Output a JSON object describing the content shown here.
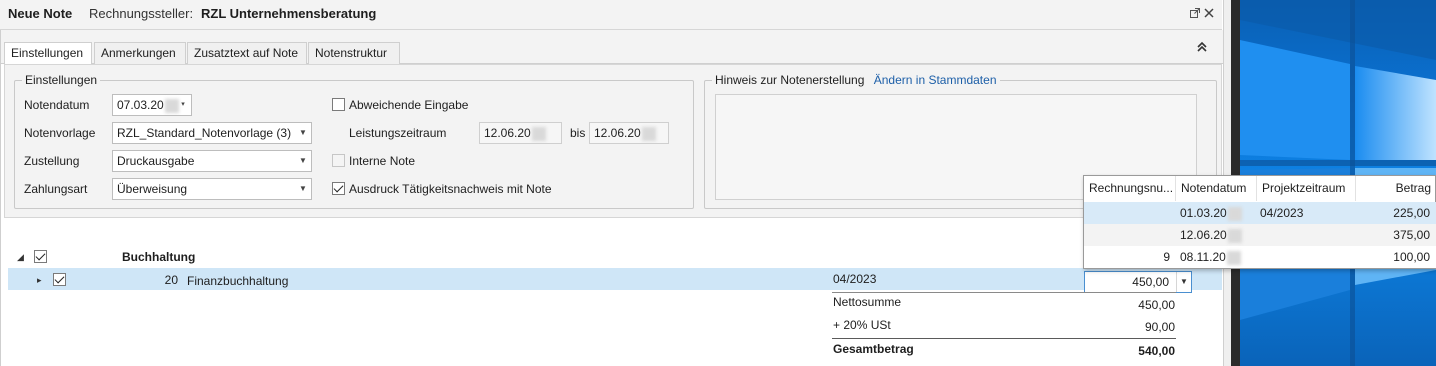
{
  "window": {
    "title": "Neue Note",
    "issuer_label": "Rechnungssteller:",
    "issuer_name": "RZL Unternehmensberatung",
    "popout_icon": "popout-icon",
    "close_icon": "close-icon"
  },
  "tabs": [
    {
      "label": "Einstellungen",
      "active": true
    },
    {
      "label": "Anmerkungen",
      "active": false
    },
    {
      "label": "Zusatztext auf Note",
      "active": false
    },
    {
      "label": "Notenstruktur",
      "active": false
    }
  ],
  "settings": {
    "group_title": "Einstellungen",
    "notendatum_label": "Notendatum",
    "notendatum_value": "07.03.20",
    "notenvorlage_label": "Notenvorlage",
    "notenvorlage_value": "RZL_Standard_Notenvorlage (3)",
    "zustellung_label": "Zustellung",
    "zustellung_value": "Druckausgabe",
    "zahlungsart_label": "Zahlungsart",
    "zahlungsart_value": "Überweisung",
    "abweichende_label": "Abweichende Eingabe",
    "abweichende_checked": false,
    "leistungszeitraum_label": "Leistungszeitraum",
    "leistung_from": "12.06.20",
    "bis_label": "bis",
    "leistung_to": "12.06.20",
    "interne_label": "Interne Note",
    "interne_checked": false,
    "ausdruck_label": "Ausdruck Tätigkeitsnachweis mit Note",
    "ausdruck_checked": true
  },
  "hint": {
    "title": "Hinweis zur Notenerstellung",
    "link": "Ändern in Stammdaten"
  },
  "tree": {
    "group_label": "Buchhaltung",
    "group_checked": true,
    "item_number": "20",
    "item_label": "Finanzbuchhaltung",
    "item_checked": true,
    "item_period": "04/2023",
    "item_amount": "450,00"
  },
  "totals": {
    "netto_label": "Nettosumme",
    "netto_value": "450,00",
    "ust_label": "+ 20% USt",
    "ust_value": "90,00",
    "gesamt_label": "Gesamtbetrag",
    "gesamt_value": "540,00"
  },
  "popup": {
    "headers": [
      "Rechnungsnu...",
      "Notendatum",
      "Projektzeitraum",
      "Betrag"
    ],
    "rows": [
      {
        "nr": "",
        "datum": "01.03.20",
        "zeitraum": "04/2023",
        "betrag": "225,00"
      },
      {
        "nr": "",
        "datum": "12.06.20",
        "zeitraum": "",
        "betrag": "375,00"
      },
      {
        "nr": "9",
        "datum": "08.11.20",
        "zeitraum": "",
        "betrag": "100,00"
      }
    ]
  },
  "colors": {
    "selection": "#cfe6f7",
    "link": "#1d5fa8",
    "desktop_blue": "#0b74d6"
  }
}
